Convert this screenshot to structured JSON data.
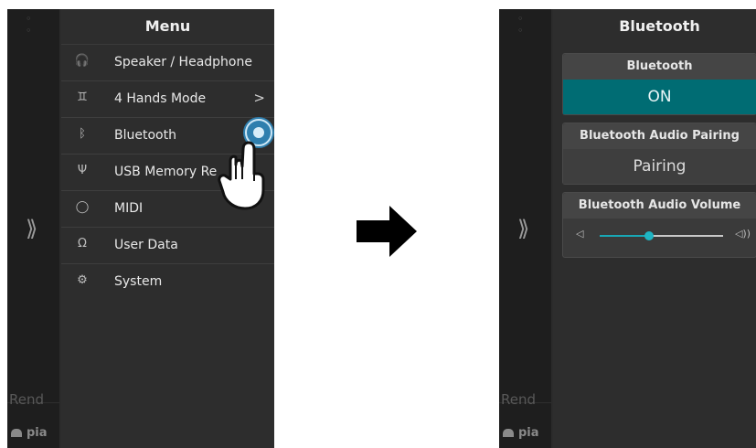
{
  "left_screen": {
    "edge": {
      "chevron": "⟫",
      "partial_text": "Rend",
      "partial_label": "pia",
      "icon": "piano-icon"
    },
    "menu": {
      "title": "Menu",
      "items": [
        {
          "label": "Speaker / Headphone",
          "icon": "headphone-icon",
          "glyph": "🎧"
        },
        {
          "label": "4 Hands Mode",
          "icon": "four-hands-icon",
          "glyph": "♊",
          "arrow": ">"
        },
        {
          "label": "Bluetooth",
          "icon": "bluetooth-icon",
          "glyph": "ᛒ"
        },
        {
          "label": "USB Memory Re",
          "icon": "usb-icon",
          "glyph": "Ψ"
        },
        {
          "label": "MIDI",
          "icon": "midi-icon",
          "glyph": "◯"
        },
        {
          "label": "User Data",
          "icon": "user-icon",
          "glyph": "Ω"
        },
        {
          "label": "System",
          "icon": "gear-icon",
          "glyph": "⚙"
        }
      ]
    }
  },
  "right_screen": {
    "edge": {
      "chevron": "⟫",
      "partial_text": "Rend",
      "partial_label": "pia",
      "icon": "piano-icon"
    },
    "title": "Bluetooth",
    "bluetooth": {
      "header": "Bluetooth",
      "value": "ON"
    },
    "pairing": {
      "header": "Bluetooth Audio Pairing",
      "value": "Pairing"
    },
    "volume": {
      "header": "Bluetooth Audio Volume",
      "level": 0.4,
      "low_icon": "◁",
      "high_icon": "◁))"
    }
  },
  "colors": {
    "accent": "#006c73",
    "touch": "#2f7fae",
    "slider": "#1fb5c4"
  }
}
